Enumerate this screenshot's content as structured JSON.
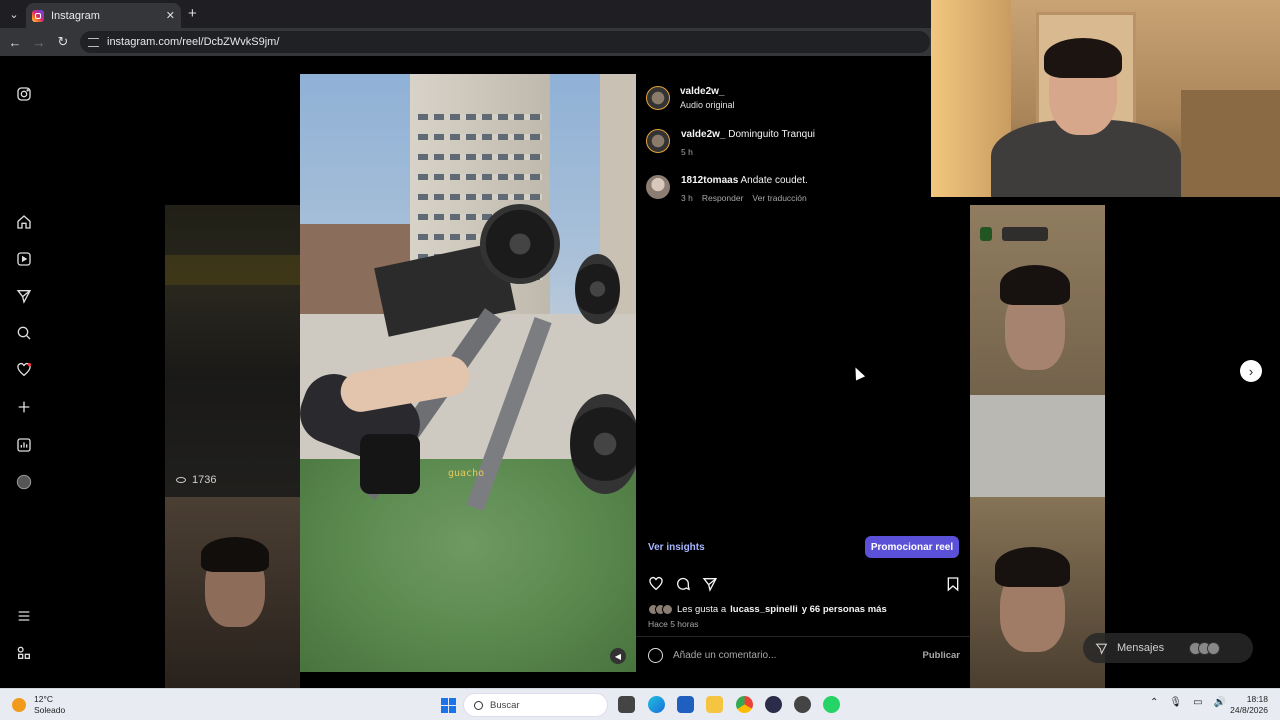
{
  "browser": {
    "tab_title": "Instagram",
    "url": "instagram.com/reel/DcbZWvkS9jm/"
  },
  "sidenav": {
    "icons": [
      "instagram-logo-icon",
      "home-icon",
      "reels-icon",
      "send-icon",
      "search-icon",
      "heart-icon",
      "plus-icon",
      "insights-icon",
      "profile-avatar",
      "menu-icon",
      "meta-apps-icon"
    ]
  },
  "background": {
    "view_count": "1736"
  },
  "video": {
    "caption_overlay": "guacho"
  },
  "panel": {
    "author": {
      "username": "valde2w_",
      "audio": "Audio original"
    },
    "comments": [
      {
        "username": "valde2w_",
        "text": "Dominguito Tranqui",
        "time": "5 h",
        "reply": "",
        "translate": ""
      },
      {
        "username": "1812tomaas",
        "text": "Andate coudet.",
        "time": "3 h",
        "reply": "Responder",
        "translate": "Ver traducción"
      }
    ],
    "insights_label": "Ver insights",
    "promote_label": "Promocionar reel",
    "likes_prefix": "Les gusta a",
    "likes_user": "lucass_spinelli",
    "likes_suffix": "y 66 personas más",
    "time_ago": "Hace 5 horas",
    "comment_placeholder": "Añade un comentario...",
    "publish_label": "Publicar"
  },
  "messages": {
    "label": "Mensajes"
  },
  "taskbar": {
    "temperature": "12°C",
    "weather": "Soleado",
    "search_placeholder": "Buscar",
    "time": "18:18",
    "date": "24/8/2026"
  },
  "colors": {
    "accent": "#5b51d8",
    "insights": "#a8b6ff",
    "background": "#000000"
  }
}
